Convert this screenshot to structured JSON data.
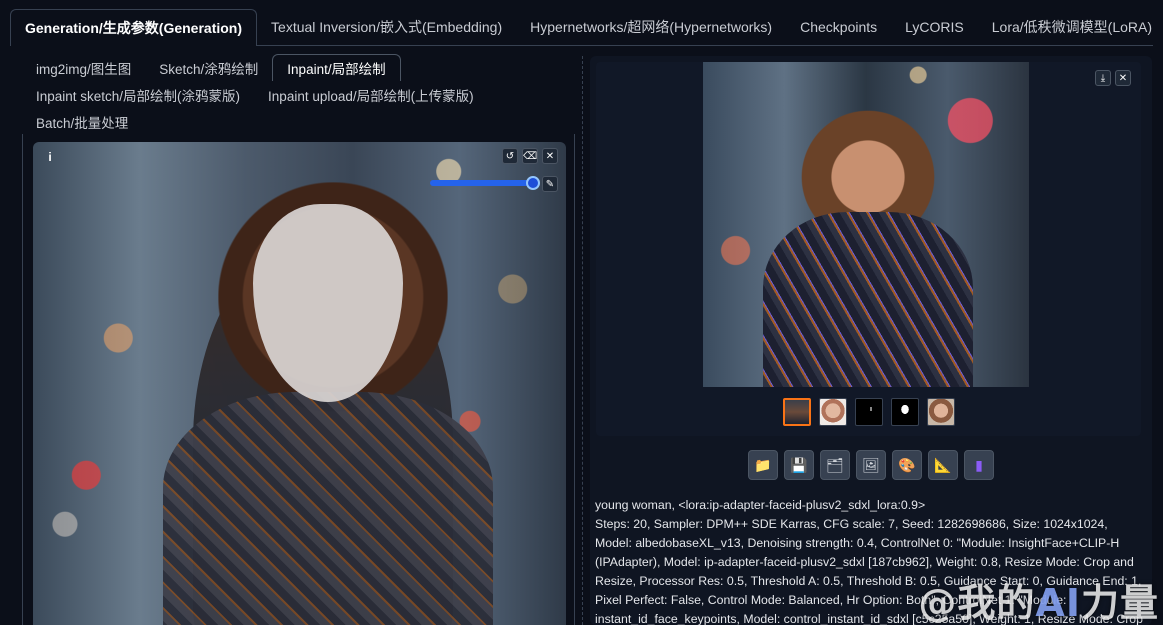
{
  "top_tabs": [
    {
      "label": "Generation/生成参数(Generation)",
      "active": true
    },
    {
      "label": "Textual Inversion/嵌入式(Embedding)",
      "active": false
    },
    {
      "label": "Hypernetworks/超网络(Hypernetworks)",
      "active": false
    },
    {
      "label": "Checkpoints",
      "active": false
    },
    {
      "label": "LyCORIS",
      "active": false
    },
    {
      "label": "Lora/低秩微调模型(LoRA)",
      "active": false
    }
  ],
  "sub_tabs": {
    "row1": [
      {
        "label": "img2img/图生图",
        "active": false
      },
      {
        "label": "Sketch/涂鸦绘制",
        "active": false
      },
      {
        "label": "Inpaint/局部绘制",
        "active": true
      }
    ],
    "row2": [
      {
        "label": "Inpaint sketch/局部绘制(涂鸦蒙版)",
        "active": false
      },
      {
        "label": "Inpaint upload/局部绘制(上传蒙版)",
        "active": false
      }
    ],
    "row3": [
      {
        "label": "Batch/批量处理",
        "active": false
      }
    ]
  },
  "canvas": {
    "info_label": "i",
    "tool_icons": [
      "undo-icon",
      "eraser-icon",
      "close-icon"
    ],
    "brush_icon": "brush-icon",
    "brush_level": 1.0
  },
  "gallery": {
    "tool_icons": [
      "download-icon",
      "close-icon"
    ],
    "thumbnails": 5,
    "selected_thumbnail": 0
  },
  "actions": [
    {
      "icon": "folder-icon",
      "glyph": "📁"
    },
    {
      "icon": "save-icon",
      "glyph": "💾"
    },
    {
      "icon": "archive-icon",
      "glyph": "🗂"
    },
    {
      "icon": "image-icon",
      "glyph": "🖼"
    },
    {
      "icon": "palette-icon",
      "glyph": "🎨"
    },
    {
      "icon": "ruler-icon",
      "glyph": "📐"
    },
    {
      "icon": "battery-icon",
      "glyph": "▮"
    }
  ],
  "generation_info": {
    "prompt": "young woman, <lora:ip-adapter-faceid-plusv2_sdxl_lora:0.9>",
    "params": "Steps: 20, Sampler: DPM++ SDE Karras, CFG scale: 7, Seed: 1282698686, Size: 1024x1024, Model: albedobaseXL_v13, Denoising strength: 0.4, ControlNet 0: \"Module: InsightFace+CLIP-H (IPAdapter), Model: ip-adapter-faceid-plusv2_sdxl [187cb962], Weight: 0.8, Resize Mode: Crop and Resize, Processor Res: 0.5, Threshold A: 0.5, Threshold B: 0.5, Guidance Start: 0, Guidance End: 1, Pixel Perfect: False, Control Mode: Balanced, Hr Option: Both\", ControlNet 1: \"Module: instant_id_face_keypoints, Model: control_instant_id_sdxl [c5c25a50], Weight: 1, Resize Mode: Crop"
  },
  "watermark": {
    "prefix": "@我的",
    "ai": "AI",
    "suffix": "力量"
  }
}
